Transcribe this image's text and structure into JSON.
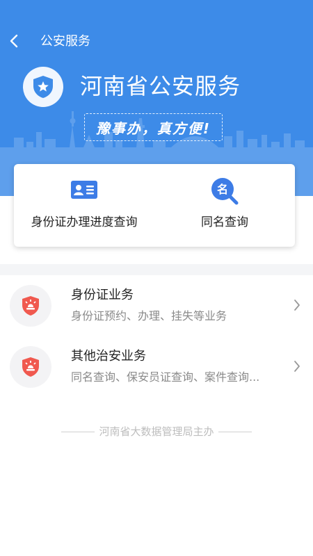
{
  "header": {
    "back_icon": "chevron-left-icon",
    "title": "公安服务"
  },
  "hero": {
    "emblem_icon": "police-shield-icon",
    "title": "河南省公安服务",
    "slogan": "豫事办，真方便!"
  },
  "quick_actions": [
    {
      "label": "身份证办理进度查询",
      "icon": "id-card-icon"
    },
    {
      "label": "同名查询",
      "icon": "name-search-icon"
    }
  ],
  "services": [
    {
      "title": "身份证业务",
      "subtitle": "身份证预约、办理、挂失等业务",
      "icon": "police-badge-icon"
    },
    {
      "title": "其他治安业务",
      "subtitle": "同名查询、保安员证查询、案件查询...",
      "icon": "police-badge-icon"
    }
  ],
  "footer": {
    "text": "河南省大数据管理局主办"
  },
  "colors": {
    "primary_blue": "#3d8be8",
    "badge_red": "#f0594f",
    "text_dark": "#222222",
    "text_gray": "#8a8a8a"
  }
}
